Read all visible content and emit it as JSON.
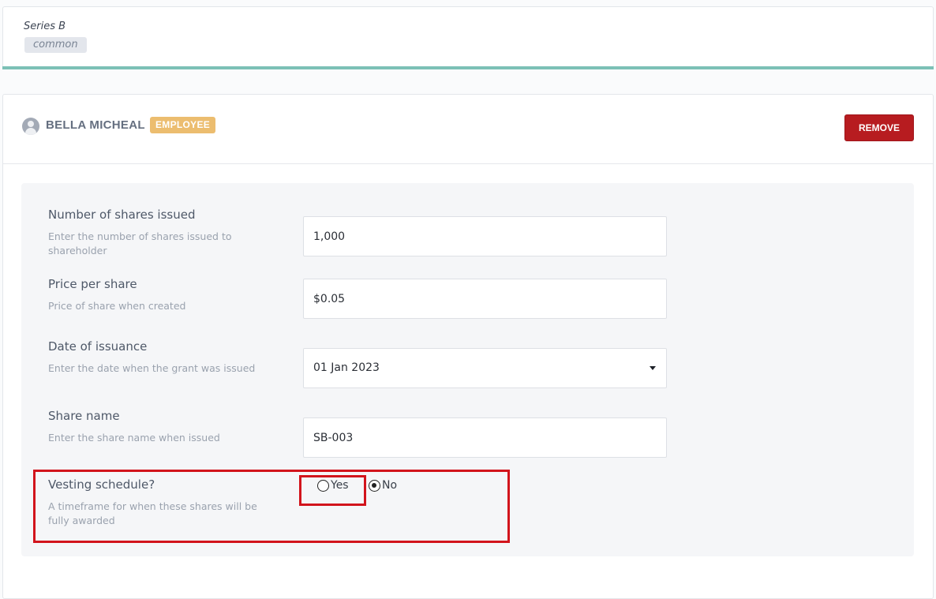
{
  "series": {
    "name": "Series B",
    "tag": "common"
  },
  "shareholder": {
    "name": "BELLA MICHEAL",
    "role": "EMPLOYEE",
    "remove_label": "REMOVE"
  },
  "form": {
    "shares_issued": {
      "label": "Number of shares issued",
      "help": "Enter the number of shares issued to shareholder",
      "value": "1,000"
    },
    "price_per_share": {
      "label": "Price per share",
      "help": "Price of share when created",
      "value": "$0.05"
    },
    "date_of_issuance": {
      "label": "Date of issuance",
      "help": "Enter the date when the grant was issued",
      "value": "01 Jan 2023"
    },
    "share_name": {
      "label": "Share name",
      "help": "Enter the share name when issued",
      "value": "SB-003"
    },
    "vesting_schedule": {
      "label": "Vesting schedule?",
      "help": "A timeframe for when these shares will be fully awarded",
      "options": [
        "Yes",
        "No"
      ],
      "selected": "No"
    }
  },
  "colors": {
    "accent_teal": "#7cc0b6",
    "remove_red": "#b71c20",
    "badge_orange": "#ecbd6f",
    "highlight_red": "#d2141c"
  }
}
